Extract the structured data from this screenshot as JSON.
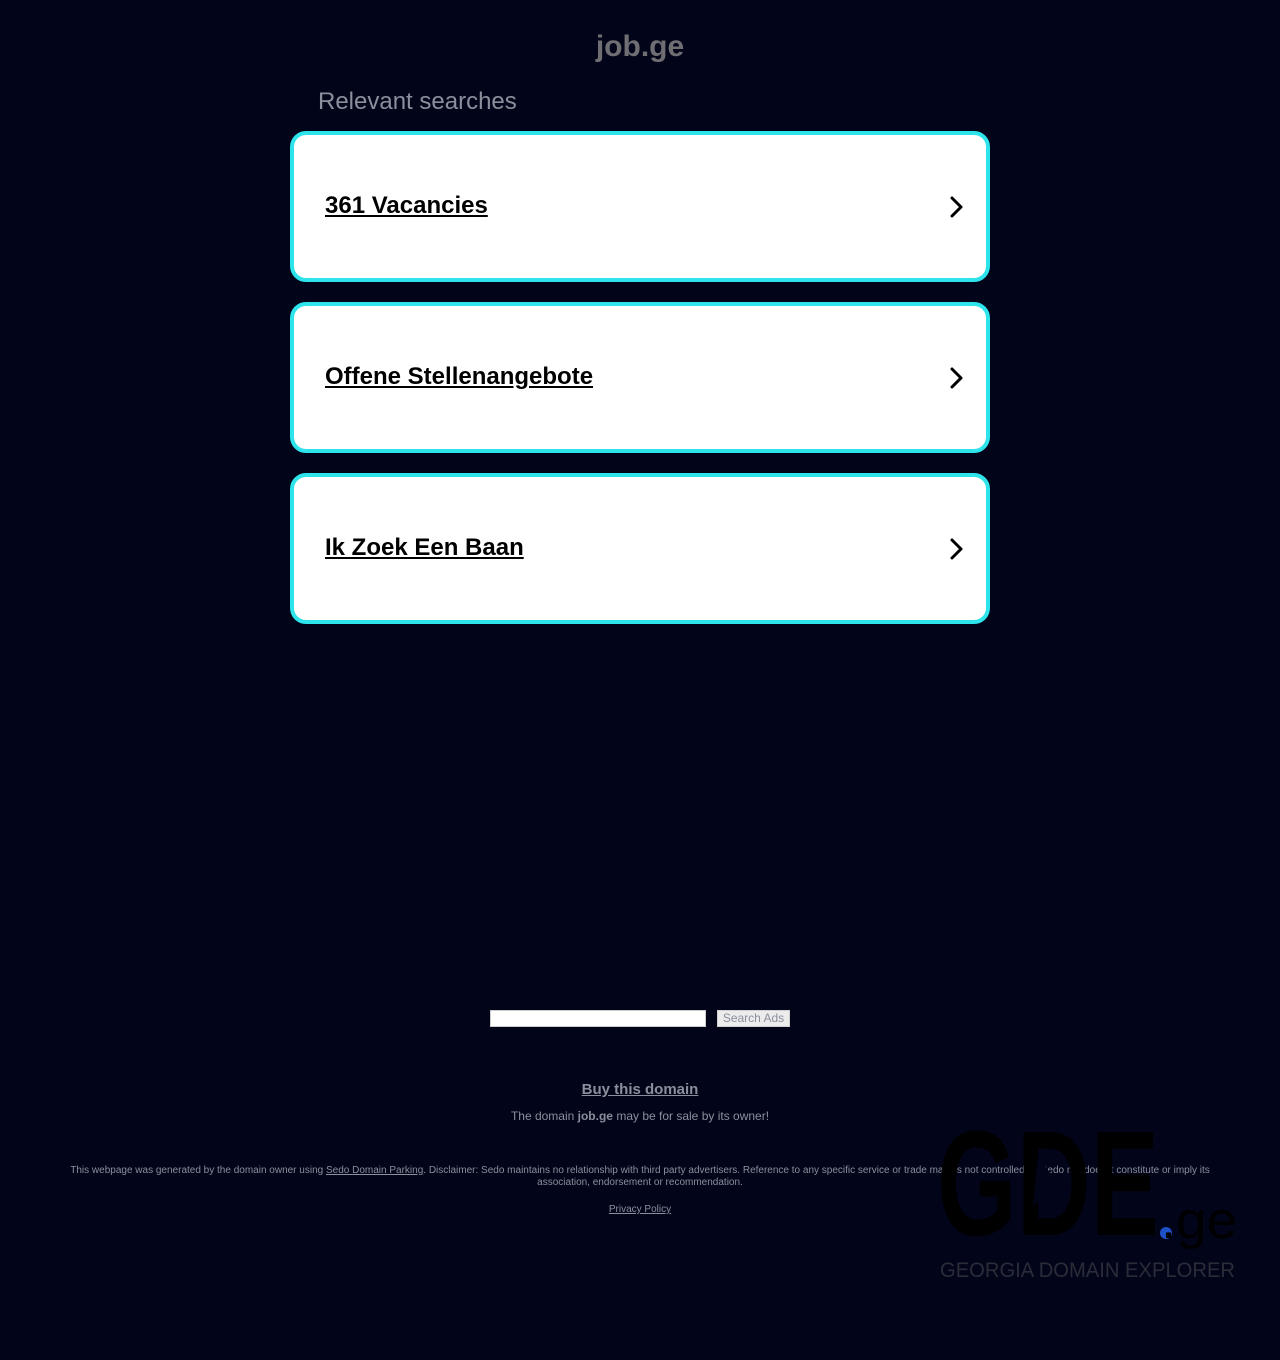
{
  "header": {
    "domain": "job.ge"
  },
  "main": {
    "heading": "Relevant searches",
    "cards": [
      {
        "label": "361 Vacancies"
      },
      {
        "label": "Offene Stellenangebote"
      },
      {
        "label": "Ik Zoek Een Baan"
      }
    ]
  },
  "search": {
    "input_value": "",
    "button_label": "Search Ads"
  },
  "footer": {
    "buy_label": "Buy this domain",
    "sale_prefix": "The domain ",
    "sale_domain": "job.ge",
    "sale_suffix": " may be for sale by its owner!",
    "disclaimer_prefix": "This webpage was generated by the domain owner using ",
    "disclaimer_link": "Sedo Domain Parking",
    "disclaimer_text": ". Disclaimer: Sedo maintains no relationship with third party advertisers. Reference to any specific service or trade mark is not controlled by Sedo nor does it constitute or imply its association, endorsement or recommendation.",
    "privacy_label": "Privacy Policy"
  },
  "watermark": {
    "logo_text": "GDE",
    "logo_suffix": ".ge",
    "tagline": "GEORGIA DOMAIN EXPLORER"
  },
  "colors": {
    "background": "#02041a",
    "card_border": "#2de4ea",
    "text_muted": "#8a8f9b",
    "watermark_dot": "#1e50c8"
  },
  "icons": {
    "card_arrow": "chevron-right-icon"
  }
}
